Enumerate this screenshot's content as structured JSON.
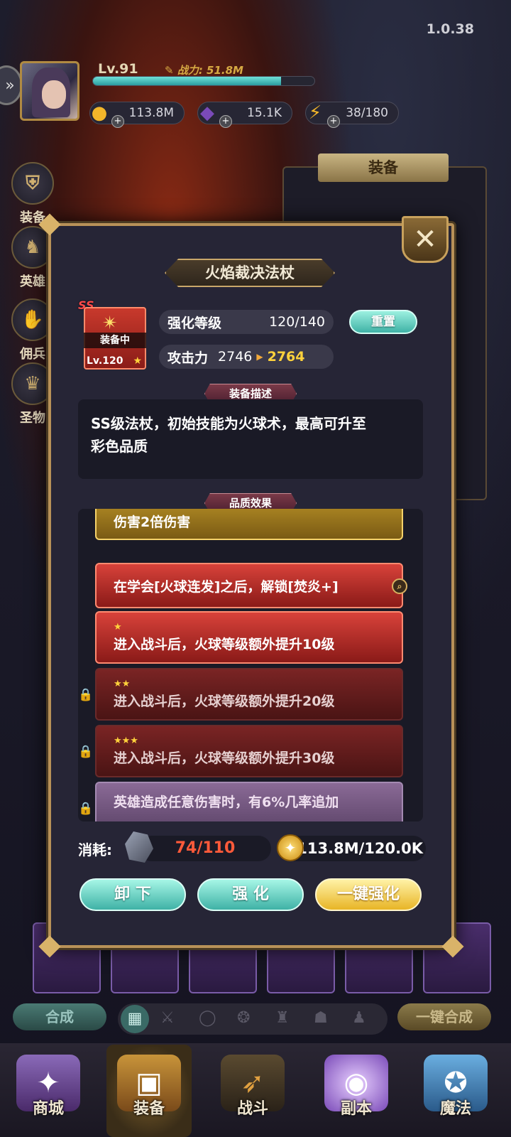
{
  "app": {
    "version": "1.0.38"
  },
  "player": {
    "level": "Lv.91",
    "power": "战力: 51.8M",
    "xp_progress": 0.85,
    "gold": "113.8M",
    "gems": "15.1K",
    "energy": "38/180"
  },
  "sidebar": {
    "items": [
      {
        "label": "装备",
        "icon": "helmet-icon"
      },
      {
        "label": "英雄",
        "icon": "hero-icon"
      },
      {
        "label": "佣兵",
        "icon": "handshake-icon"
      },
      {
        "label": "圣物",
        "icon": "trophy-icon"
      }
    ]
  },
  "equip_panel": {
    "title": "装备"
  },
  "filter": {
    "merge_label": "合成",
    "one_click_merge_label": "一键合成"
  },
  "bottom_nav": {
    "items": [
      {
        "label": "商城",
        "icon": "shop-icon"
      },
      {
        "label": "装备",
        "icon": "chest-icon",
        "active": true
      },
      {
        "label": "战斗",
        "icon": "bow-icon"
      },
      {
        "label": "副本",
        "icon": "portal-icon"
      },
      {
        "label": "魔法",
        "icon": "spellbook-icon"
      }
    ]
  },
  "modal": {
    "title": "火焰裁决法杖",
    "item": {
      "rank": "SS",
      "status": "装备中",
      "level": "Lv.120",
      "color": "#c8392c"
    },
    "enhance": {
      "label": "强化等级",
      "value": "120/140"
    },
    "reset_label": "重置",
    "attack": {
      "label": "攻击力",
      "current": "2746",
      "next": "2764"
    },
    "desc_title": "装备描述",
    "description_line1": "SS级法杖，初始技能为火球术，最高可升至",
    "description_line2": "彩色品质",
    "effects_title": "品质效果",
    "effects": [
      {
        "text": "伤害2倍伤害",
        "style": "gold",
        "stars": "",
        "locked": false
      },
      {
        "text": "在学会[火球连发]之后，解锁[焚炎+]",
        "style": "red",
        "stars": "",
        "locked": false
      },
      {
        "text": "进入战斗后，火球等级额外提升10级",
        "style": "red",
        "stars": "★",
        "locked": false
      },
      {
        "text": "进入战斗后，火球等级额外提升20级",
        "style": "dark",
        "stars": "★★",
        "locked": true
      },
      {
        "text": "进入战斗后，火球等级额外提升30级",
        "style": "dark",
        "stars": "★★★",
        "locked": true
      },
      {
        "text": "英雄造成任意伤害时，有6%几率追加",
        "style": "purple",
        "stars": "",
        "locked": true
      }
    ],
    "cost_label": "消耗:",
    "ore_cost": "74/110",
    "gold_cost": "113.8M/120.0K",
    "buttons": {
      "unequip": "卸 下",
      "enhance": "强 化",
      "auto_enhance": "一键强化"
    }
  }
}
